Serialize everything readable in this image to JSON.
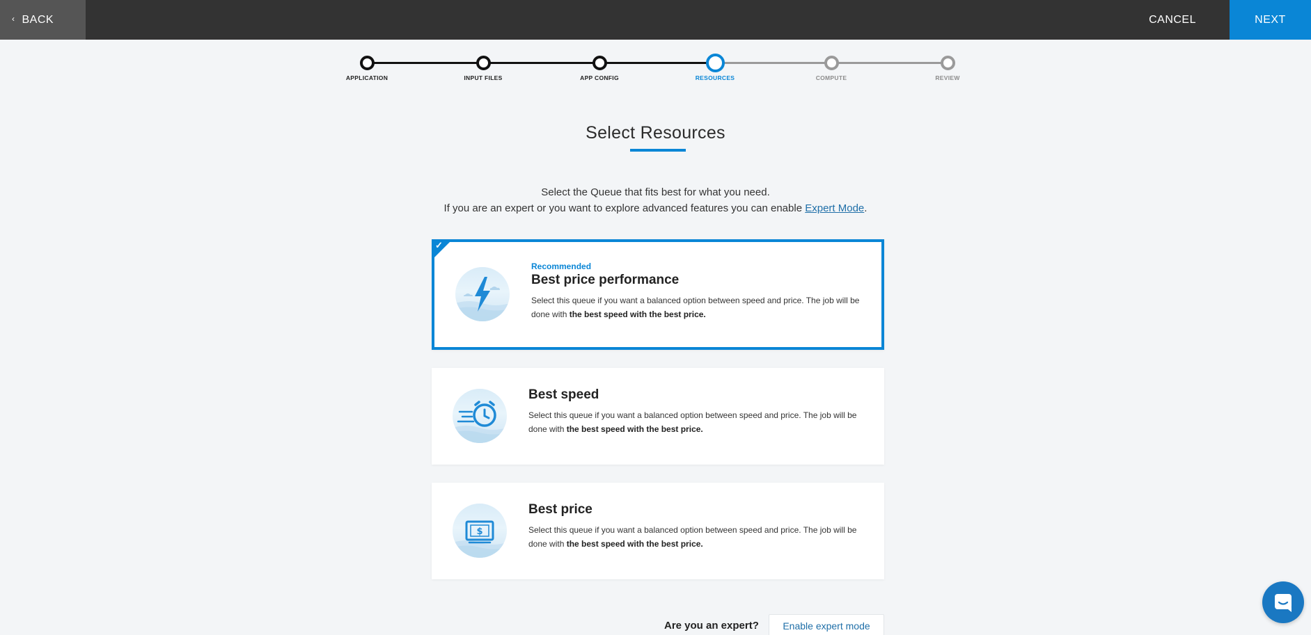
{
  "topbar": {
    "back_label": "BACK",
    "cancel_label": "CANCEL",
    "next_label": "NEXT"
  },
  "stepper": {
    "steps": [
      {
        "label": "APPLICATION",
        "state": "done"
      },
      {
        "label": "INPUT FILES",
        "state": "done"
      },
      {
        "label": "APP CONFIG",
        "state": "done"
      },
      {
        "label": "RESOURCES",
        "state": "active"
      },
      {
        "label": "COMPUTE",
        "state": "future"
      },
      {
        "label": "REVIEW",
        "state": "future"
      }
    ]
  },
  "main": {
    "title": "Select Resources",
    "intro_line1": "Select the Queue that fits best for what you need.",
    "intro_line2_prefix": "If you are an expert or you want to explore advanced features you can enable ",
    "intro_link": "Expert Mode",
    "intro_line2_suffix": "."
  },
  "queues": [
    {
      "badge": "Recommended",
      "title": "Best price performance",
      "desc_prefix": "Select this queue if you want a balanced option between speed and price. The job will be done with ",
      "desc_bold": "the best speed with the best price.",
      "icon": "lightning-icon",
      "selected": true
    },
    {
      "title": "Best speed",
      "desc_prefix": "Select this queue if you want a balanced option between speed and price. The job will be done with ",
      "desc_bold": "the best speed with the best price.",
      "icon": "fast-clock-icon",
      "selected": false
    },
    {
      "title": "Best price",
      "desc_prefix": "Select this queue if you want a balanced option between speed and price. The job will be done with ",
      "desc_bold": "the best speed with the best price.",
      "icon": "dollar-bill-icon",
      "selected": false
    }
  ],
  "expert": {
    "question": "Are you an expert?",
    "button_label": "Enable expert mode"
  },
  "colors": {
    "accent": "#0a86d6",
    "topbar": "#333333",
    "background": "#f3f5f7"
  }
}
